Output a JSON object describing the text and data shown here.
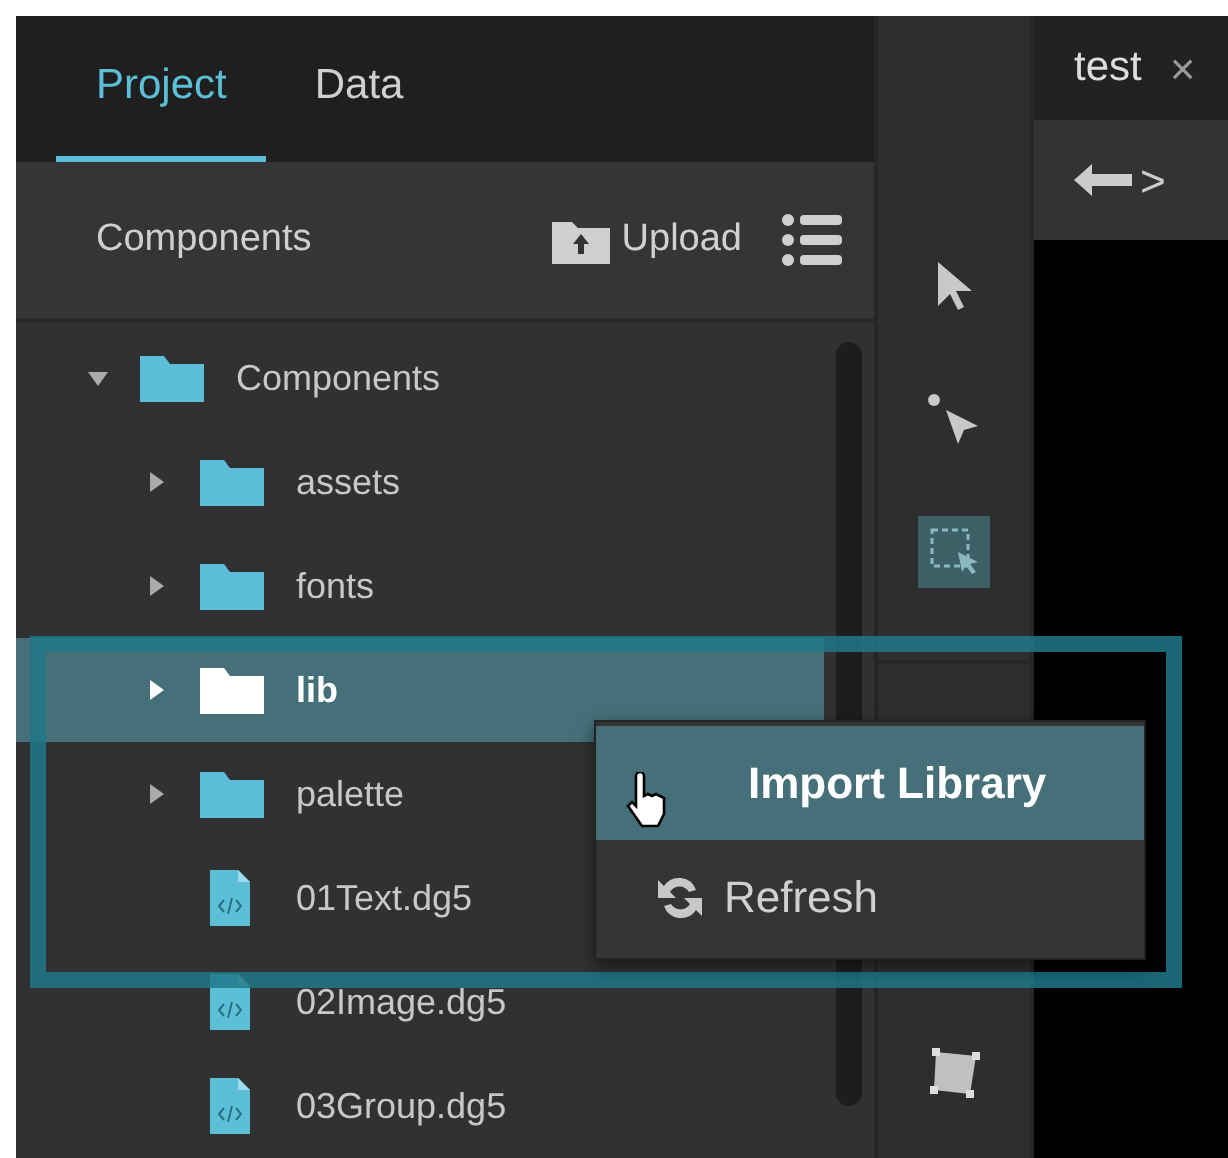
{
  "tabs": [
    {
      "label": "Project",
      "selected": true
    },
    {
      "label": "Data",
      "selected": false
    }
  ],
  "panel_header": {
    "title": "Components",
    "upload": "Upload"
  },
  "tree": [
    {
      "label": "Components",
      "kind": "folder",
      "expanded": true,
      "selected": false,
      "children": [
        {
          "label": "assets",
          "kind": "folder",
          "expanded": false,
          "selected": false
        },
        {
          "label": "fonts",
          "kind": "folder",
          "expanded": false,
          "selected": false
        },
        {
          "label": "lib",
          "kind": "folder",
          "expanded": false,
          "selected": true
        },
        {
          "label": "palette",
          "kind": "folder",
          "expanded": false,
          "selected": false
        },
        {
          "label": "01Text.dg5",
          "kind": "file",
          "selected": false
        },
        {
          "label": "02Image.dg5",
          "kind": "file",
          "selected": false
        },
        {
          "label": "03Group.dg5",
          "kind": "file",
          "selected": false
        }
      ]
    }
  ],
  "context_menu": [
    {
      "label": "Import Library",
      "kind": "import",
      "selected": true
    },
    {
      "label": "Refresh",
      "kind": "refresh",
      "selected": false
    }
  ],
  "tools": [
    {
      "kind": "select",
      "selected": false
    },
    {
      "kind": "direct-select",
      "selected": false
    },
    {
      "kind": "marquee",
      "selected": true
    },
    {
      "kind": "shape",
      "selected": false
    }
  ],
  "editor_tab": {
    "label": "test",
    "close": "×"
  },
  "editor_nav": {
    "forward": ">"
  }
}
